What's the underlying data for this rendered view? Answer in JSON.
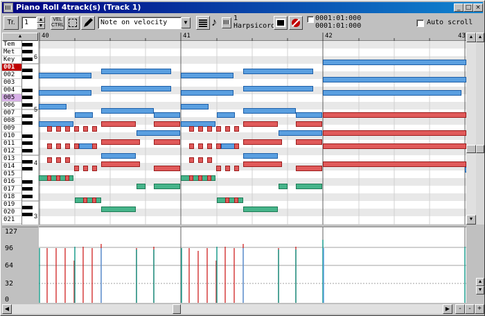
{
  "window": {
    "title": "Piano Roll 4track(s) (Track 1)",
    "controls": {
      "minimize": "_",
      "maximize": "□",
      "close": "×"
    }
  },
  "toolbar": {
    "track_label": "Tr.",
    "track_value": "1",
    "vel_ctrl_label": "VEL\nCTRL",
    "mode_value": "Note on velocity",
    "instrument_number": "1",
    "instrument_name": "Harpsicord",
    "position_start": "0001:01:000",
    "position_end": "0001:01:000",
    "auto_scroll_label": "Auto scroll",
    "auto_scroll_checked": false
  },
  "ruler": {
    "measures": [
      "40",
      "41",
      "42",
      "43"
    ]
  },
  "tracks": [
    {
      "label": "Tem",
      "selected": false
    },
    {
      "label": "Met",
      "selected": false
    },
    {
      "label": "Key",
      "selected": false
    },
    {
      "label": "001",
      "selected": true,
      "color": "#c00000"
    },
    {
      "label": "002",
      "selected": false
    },
    {
      "label": "003",
      "selected": false
    },
    {
      "label": "004",
      "selected": false
    },
    {
      "label": "005",
      "selected": false,
      "color": "#d8b0e8"
    },
    {
      "label": "006",
      "selected": false
    },
    {
      "label": "007",
      "selected": false
    },
    {
      "label": "008",
      "selected": false
    },
    {
      "label": "009",
      "selected": false
    },
    {
      "label": "010",
      "selected": false
    },
    {
      "label": "011",
      "selected": false
    },
    {
      "label": "012",
      "selected": false
    },
    {
      "label": "013",
      "selected": false
    },
    {
      "label": "014",
      "selected": false
    },
    {
      "label": "015",
      "selected": false
    },
    {
      "label": "016",
      "selected": false
    },
    {
      "label": "017",
      "selected": false
    },
    {
      "label": "018",
      "selected": false
    },
    {
      "label": "019",
      "selected": false
    },
    {
      "label": "020",
      "selected": false
    },
    {
      "label": "021",
      "selected": false
    }
  ],
  "octave_labels": [
    "6",
    "5",
    "4",
    "3"
  ],
  "velocity_axis": {
    "ticks": [
      "127",
      "96",
      "64",
      "32",
      "0"
    ]
  },
  "colors": {
    "blue_track": "#5a9fe0",
    "red_track": "#e05a5a",
    "green_track": "#46b48a"
  },
  "icons": [
    "pencil-icon",
    "select-icon",
    "piano-icon",
    "note-icon",
    "instrument-icon",
    "display-icon",
    "record-icon"
  ]
}
